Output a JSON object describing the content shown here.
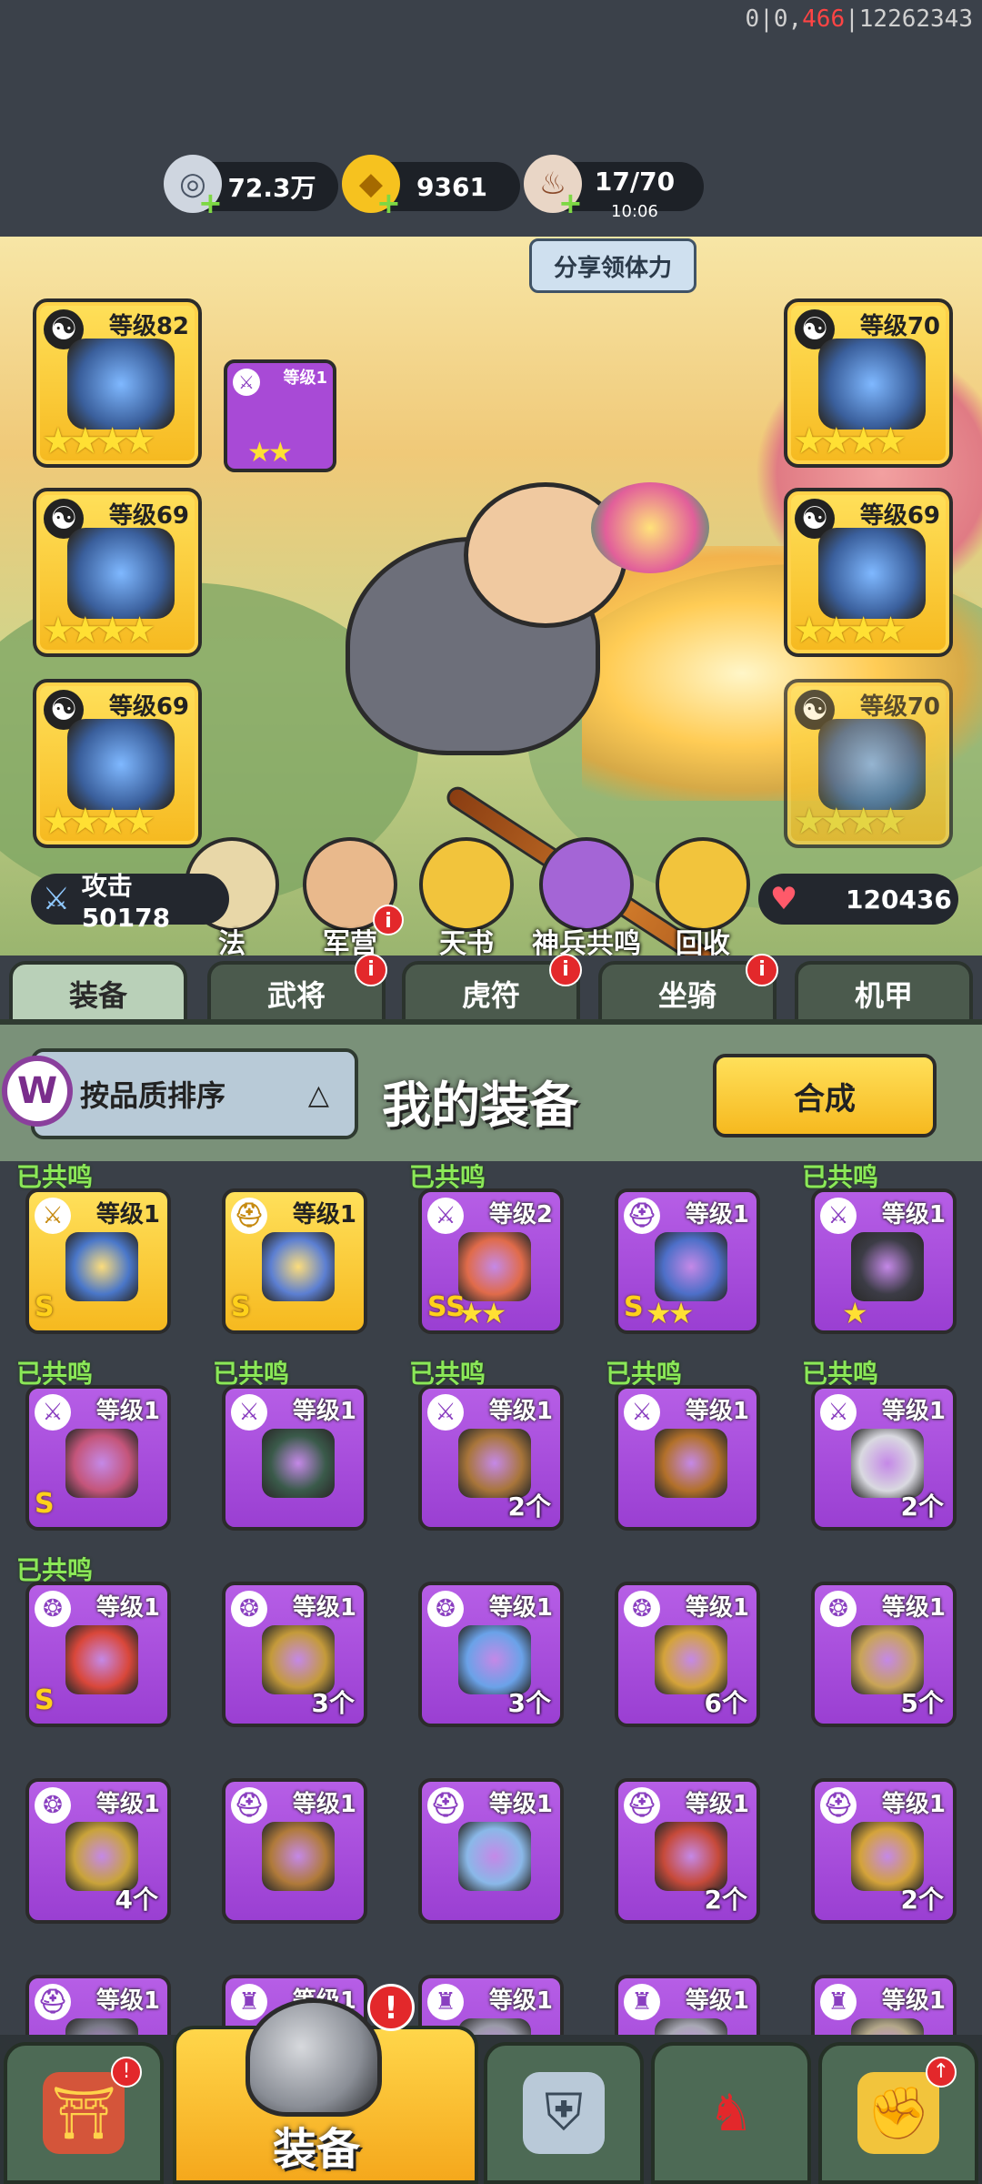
{
  "debug": {
    "prefix": "0|0,",
    "red": "466",
    "suffix": "|12262343"
  },
  "resources": {
    "silver": {
      "value": "72.3万",
      "icon": "silver-coin-icon"
    },
    "gold": {
      "value": "9361",
      "icon": "gold-ingot-icon"
    },
    "stamina": {
      "value": "17/70",
      "timer": "10:06",
      "icon": "meat-icon"
    }
  },
  "share_button": "分享领体力",
  "equipped": {
    "left": [
      {
        "level": "等级82",
        "stars": "★★★★"
      },
      {
        "level": "等级69",
        "stars": "★★★★"
      },
      {
        "level": "等级69",
        "stars": "★★★★"
      }
    ],
    "right": [
      {
        "level": "等级70",
        "stars": "★★★★"
      },
      {
        "level": "等级69",
        "stars": "★★★★"
      },
      {
        "level": "等级70",
        "stars": "★★★★"
      }
    ],
    "mini": {
      "level": "等级1",
      "stars": "★★"
    }
  },
  "hub_buttons": [
    {
      "label": "法"
    },
    {
      "label": "军营"
    },
    {
      "label": "天书"
    },
    {
      "label": "神兵共鸣"
    },
    {
      "label": "回收"
    }
  ],
  "stats": {
    "attack": "攻击 50178",
    "hp": "120436"
  },
  "tabs": [
    "装备",
    "武将",
    "虎符",
    "坐骑",
    "机甲"
  ],
  "badge_mark": "i",
  "alert_mark": "!",
  "panel": {
    "sort_label": "按品质排序",
    "sort_arrow": "△",
    "logo": "W",
    "title": "我的装备",
    "synth_label": "合成"
  },
  "resonated_label": "已共鸣",
  "items": [
    {
      "level": "等级1",
      "quality": "gold",
      "resonated": true,
      "grade": "S",
      "stars": "",
      "count": ""
    },
    {
      "level": "等级1",
      "quality": "gold",
      "resonated": false,
      "grade": "S",
      "stars": "",
      "count": ""
    },
    {
      "level": "等级2",
      "quality": "purple",
      "resonated": true,
      "grade": "SS",
      "stars": "★★",
      "count": ""
    },
    {
      "level": "等级1",
      "quality": "purple",
      "resonated": false,
      "grade": "S",
      "stars": "★★",
      "count": ""
    },
    {
      "level": "等级1",
      "quality": "purple",
      "resonated": true,
      "grade": "",
      "stars": "★",
      "count": ""
    },
    {
      "level": "等级1",
      "quality": "purple",
      "resonated": true,
      "grade": "S",
      "stars": "",
      "count": ""
    },
    {
      "level": "等级1",
      "quality": "purple",
      "resonated": true,
      "grade": "",
      "stars": "",
      "count": ""
    },
    {
      "level": "等级1",
      "quality": "purple",
      "resonated": true,
      "grade": "",
      "stars": "",
      "count": "2个"
    },
    {
      "level": "等级1",
      "quality": "purple",
      "resonated": true,
      "grade": "",
      "stars": "",
      "count": ""
    },
    {
      "level": "等级1",
      "quality": "purple",
      "resonated": true,
      "grade": "",
      "stars": "",
      "count": "2个"
    },
    {
      "level": "等级1",
      "quality": "purple",
      "resonated": true,
      "grade": "S",
      "stars": "",
      "count": ""
    },
    {
      "level": "等级1",
      "quality": "purple",
      "resonated": false,
      "grade": "",
      "stars": "",
      "count": "3个"
    },
    {
      "level": "等级1",
      "quality": "purple",
      "resonated": false,
      "grade": "",
      "stars": "",
      "count": "3个"
    },
    {
      "level": "等级1",
      "quality": "purple",
      "resonated": false,
      "grade": "",
      "stars": "",
      "count": "6个"
    },
    {
      "level": "等级1",
      "quality": "purple",
      "resonated": false,
      "grade": "",
      "stars": "",
      "count": "5个"
    },
    {
      "level": "等级1",
      "quality": "purple",
      "resonated": false,
      "grade": "",
      "stars": "",
      "count": "4个"
    },
    {
      "level": "等级1",
      "quality": "purple",
      "resonated": false,
      "grade": "",
      "stars": "",
      "count": ""
    },
    {
      "level": "等级1",
      "quality": "purple",
      "resonated": false,
      "grade": "",
      "stars": "",
      "count": ""
    },
    {
      "level": "等级1",
      "quality": "purple",
      "resonated": false,
      "grade": "",
      "stars": "",
      "count": "2个"
    },
    {
      "level": "等级1",
      "quality": "purple",
      "resonated": false,
      "grade": "",
      "stars": "",
      "count": "2个"
    },
    {
      "level": "等级1",
      "quality": "purple",
      "resonated": false,
      "grade": "",
      "stars": "",
      "count": ""
    },
    {
      "level": "等级1",
      "quality": "purple",
      "resonated": false,
      "grade": "",
      "stars": "",
      "count": ""
    },
    {
      "level": "等级1",
      "quality": "purple",
      "resonated": false,
      "grade": "",
      "stars": "",
      "count": ""
    },
    {
      "level": "等级1",
      "quality": "purple",
      "resonated": false,
      "grade": "",
      "stars": "",
      "count": ""
    },
    {
      "level": "等级1",
      "quality": "purple",
      "resonated": false,
      "grade": "",
      "stars": "",
      "count": ""
    }
  ],
  "item_icons": [
    "sword-icon",
    "helmet-icon",
    "sword-icon",
    "helmet-icon",
    "sword-icon",
    "sword-icon",
    "sword-icon",
    "sword-icon",
    "sword-icon",
    "sword-icon",
    "amulet-icon",
    "amulet-icon",
    "amulet-icon",
    "amulet-icon",
    "amulet-icon",
    "amulet-icon",
    "helmet-icon",
    "helmet-icon",
    "helmet-icon",
    "helmet-icon",
    "helmet-icon",
    "armor-icon",
    "armor-icon",
    "armor-icon",
    "armor-icon"
  ],
  "bottom_nav": {
    "active_label": "装备"
  },
  "colors": {
    "gold": "#f6b91f",
    "purple": "#9a3fd2",
    "resonated_green": "#8be858",
    "badge_red": "#e3282b"
  }
}
